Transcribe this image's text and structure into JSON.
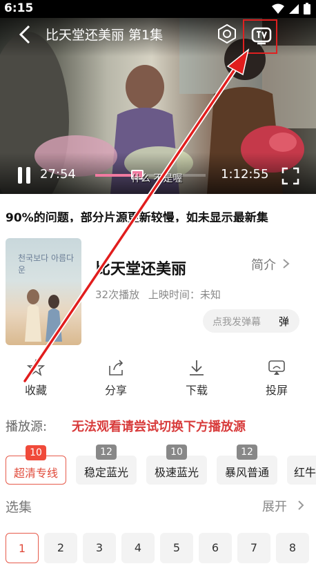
{
  "status": {
    "time": "6:15",
    "icons": [
      "wifi-icon",
      "signal-icon",
      "battery-icon"
    ]
  },
  "player": {
    "title": "比天堂还美丽 第1集",
    "current_time": "27:54",
    "duration": "1:12:55",
    "subtitle": "什么 不是喔",
    "progress_fraction": 0.38,
    "icons": [
      "back-icon",
      "hexagon-settings-icon",
      "tv-cast-icon",
      "pause-icon",
      "fullscreen-icon"
    ]
  },
  "notice": {
    "text": "90%的问题，部分片源更新较慢，如未显示最新集"
  },
  "show": {
    "poster_title": "천국보다 아름다운",
    "title": "比天堂还美丽",
    "intro_label": "简介",
    "plays": "32次播放",
    "release": "上映时间：未知",
    "danmu_placeholder": "点我发弹幕",
    "danmu_button": "弹"
  },
  "actions": [
    {
      "label": "收藏",
      "icon": "star-icon"
    },
    {
      "label": "分享",
      "icon": "share-icon"
    },
    {
      "label": "下载",
      "icon": "download-icon"
    },
    {
      "label": "投屏",
      "icon": "cast-screen-icon"
    }
  ],
  "sources": {
    "label": "播放源:",
    "warning": "无法观看请尝试切换下方播放源",
    "items": [
      {
        "name": "超清专线",
        "count": "10",
        "active": true
      },
      {
        "name": "稳定蓝光",
        "count": "12"
      },
      {
        "name": "极速蓝光",
        "count": "10"
      },
      {
        "name": "暴风普通",
        "count": "12"
      },
      {
        "name": "红牛",
        "count": ""
      }
    ]
  },
  "episodes": {
    "label": "选集",
    "expand_label": "展开",
    "items": [
      "1",
      "2",
      "3",
      "4",
      "5",
      "6",
      "7",
      "8"
    ],
    "active": "1"
  },
  "colors": {
    "accent": "#e04a3a",
    "highlight_box": "#e02020",
    "progress": "#f07aa0"
  }
}
